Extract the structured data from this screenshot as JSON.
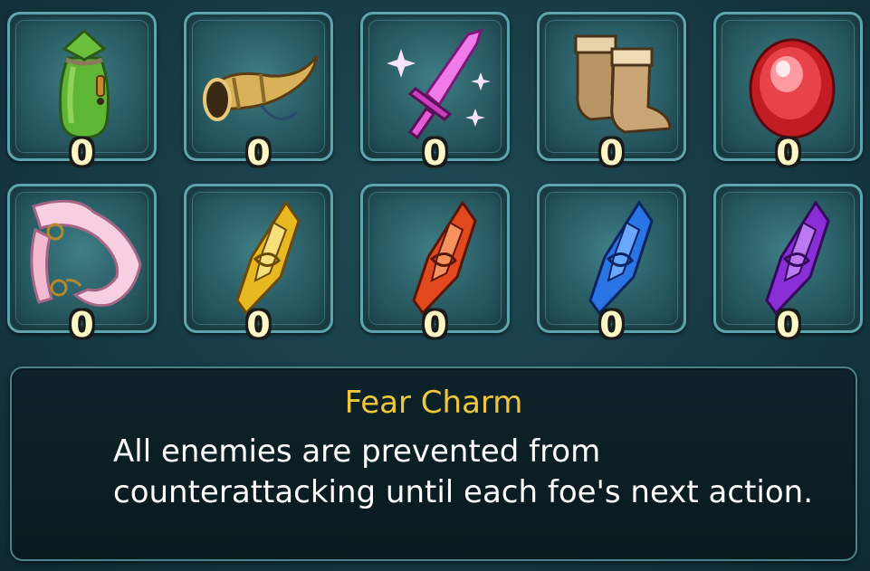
{
  "inventory": {
    "items": [
      {
        "icon": "green-pouch-icon",
        "count": "0"
      },
      {
        "icon": "horn-icon",
        "count": "0"
      },
      {
        "icon": "dagger-icon",
        "count": "0"
      },
      {
        "icon": "boots-icon",
        "count": "0"
      },
      {
        "icon": "red-gem-icon",
        "count": "0"
      },
      {
        "icon": "pink-scarf-icon",
        "count": "0"
      },
      {
        "icon": "gold-crest-icon",
        "count": "0"
      },
      {
        "icon": "red-crest-icon",
        "count": "0"
      },
      {
        "icon": "blue-crest-icon",
        "count": "0"
      },
      {
        "icon": "purple-crest-icon",
        "count": "0"
      }
    ]
  },
  "description": {
    "title": "Fear Charm",
    "text": "All enemies are prevented from counterattacking until each foe's next action."
  },
  "colors": {
    "title": "#f0c63a",
    "count": "#fff7c4",
    "slot_border": "#5ea4ad"
  }
}
